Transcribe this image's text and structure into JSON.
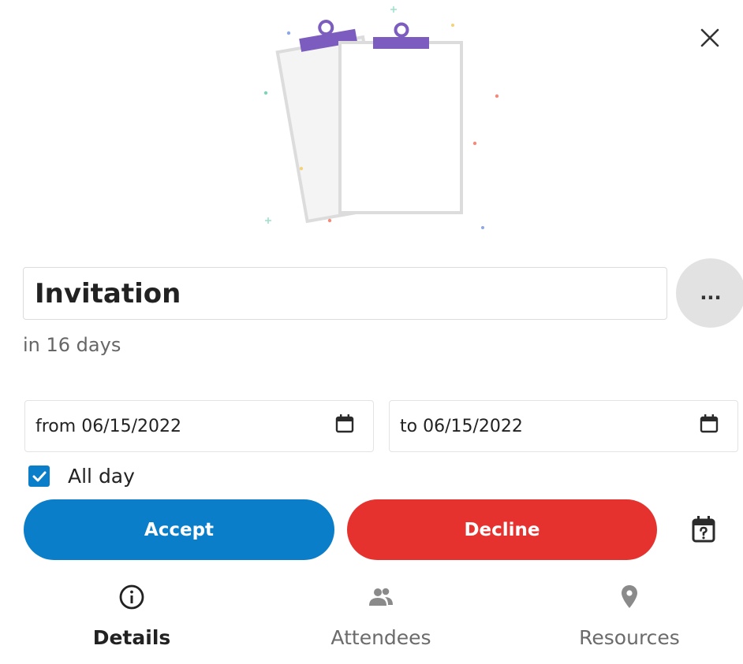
{
  "event": {
    "title": "Invitation",
    "relative_time": "in 16 days"
  },
  "dates": {
    "from": "from 06/15/2022",
    "to": "to 06/15/2022"
  },
  "all_day": {
    "label": "All day",
    "checked": true
  },
  "actions": {
    "accept": "Accept",
    "decline": "Decline",
    "more": "..."
  },
  "tabs": [
    {
      "label": "Details",
      "icon": "info-icon",
      "active": true
    },
    {
      "label": "Attendees",
      "icon": "people-icon",
      "active": false
    },
    {
      "label": "Resources",
      "icon": "location-pin-icon",
      "active": false
    }
  ],
  "colors": {
    "accept": "#0a7ec8",
    "decline": "#e5322e",
    "clip": "#7c5cbf"
  }
}
